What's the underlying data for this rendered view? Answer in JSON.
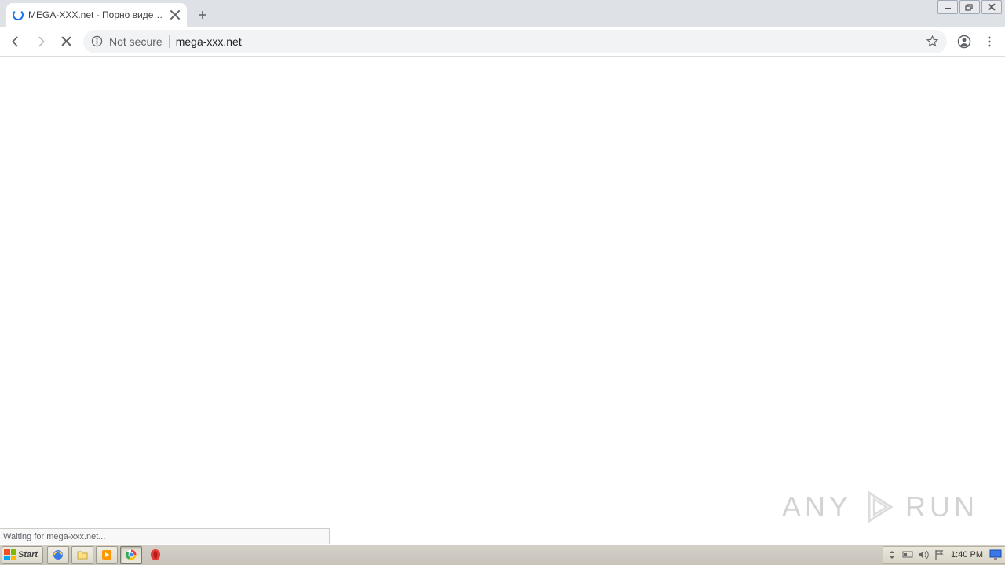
{
  "tab": {
    "title": "MEGA-XXX.net - Порно видео роли"
  },
  "addressbar": {
    "not_secure_label": "Not secure",
    "url": "mega-xxx.net"
  },
  "status": {
    "text": "Waiting for mega-xxx.net..."
  },
  "taskbar": {
    "start_label": "Start",
    "clock": "1:40 PM"
  },
  "watermark": {
    "left": "ANY",
    "right": "RUN"
  }
}
